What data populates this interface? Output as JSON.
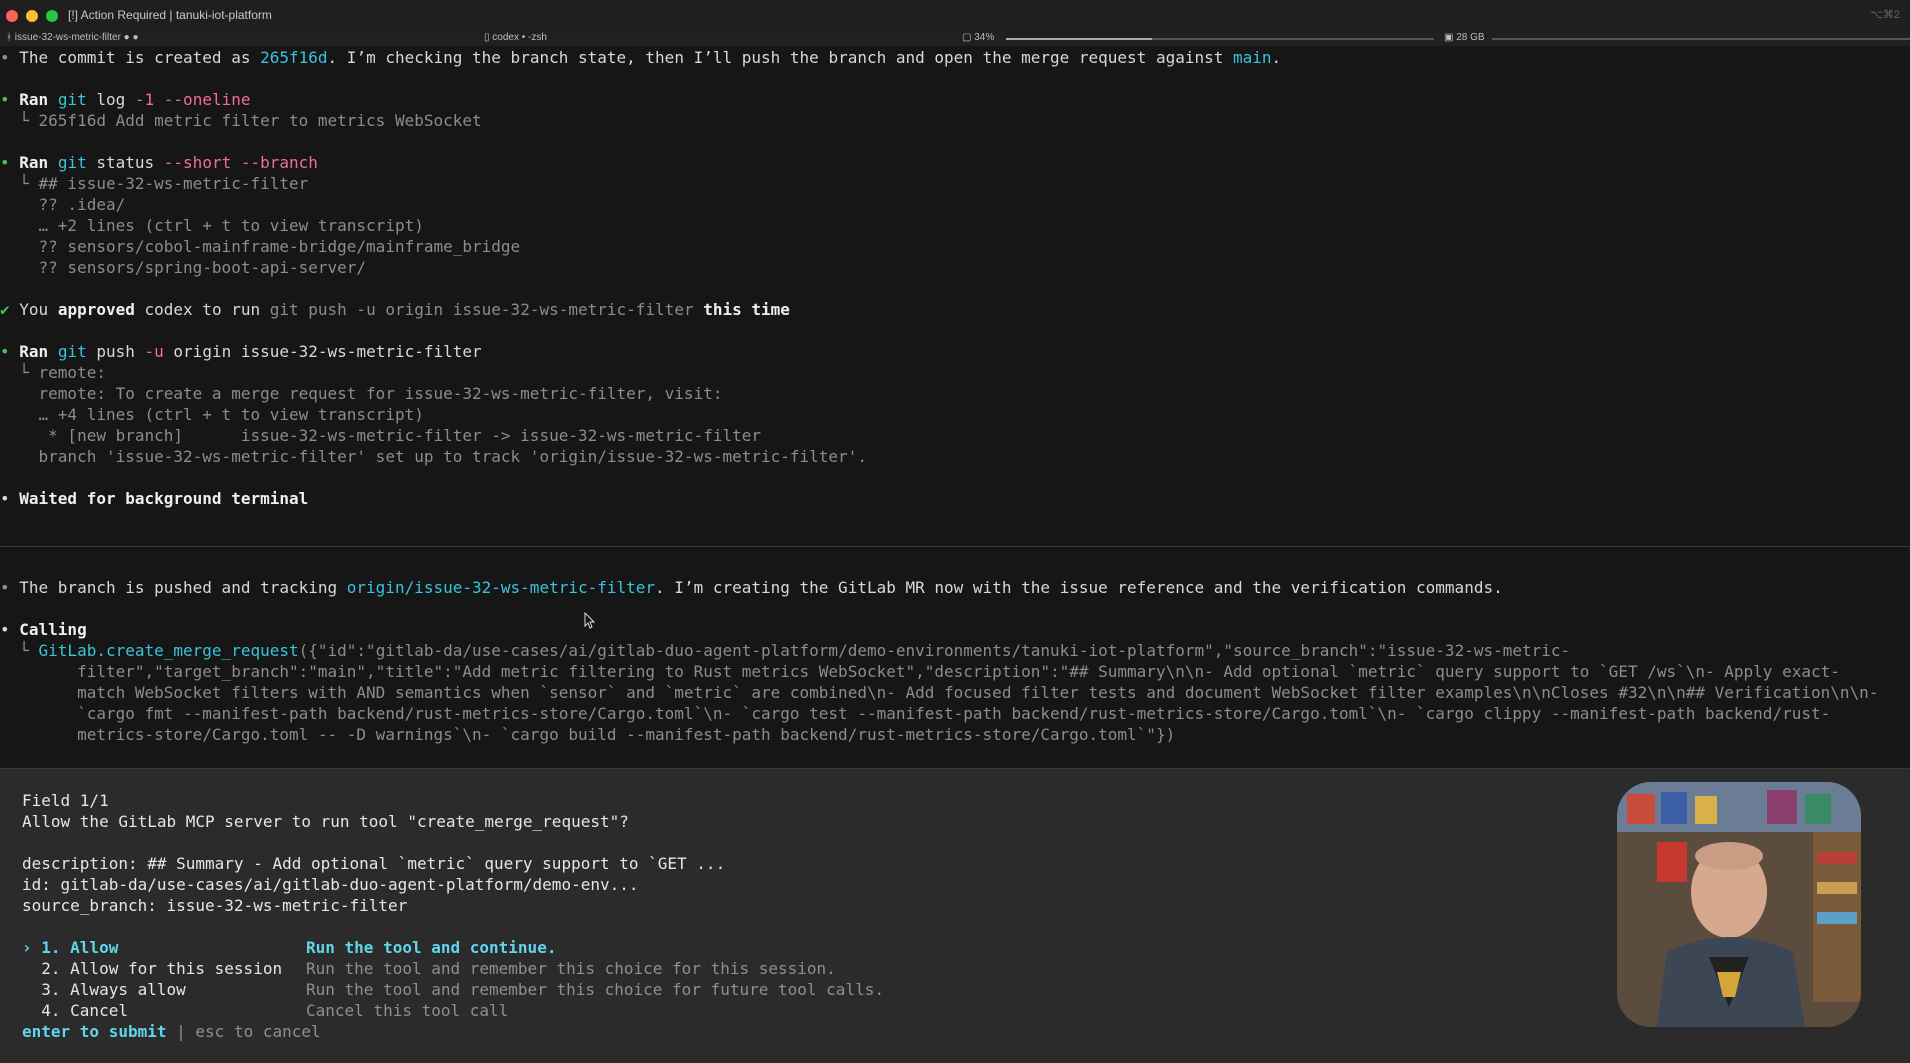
{
  "window": {
    "title": "[!] Action Required | tanuki-iot-platform",
    "shortcut_hint": "⌥⌘2"
  },
  "statusbar": {
    "branch": "issue-32-ws-metric-filter ● ●",
    "tab": "codex • -zsh",
    "cpu": "34%",
    "cpu_level": 0.34,
    "mem": "28 GB"
  },
  "terminal": {
    "commit_line": {
      "prefix": "The commit is created as ",
      "sha": "265f16d",
      "middle": ". I’m checking the branch state, then I’ll push the branch and open the merge request against ",
      "target": "main",
      "suffix": "."
    },
    "cmd1": {
      "ran": "Ran",
      "git": "git",
      "rest": " log ",
      "flags": "-1 --oneline",
      "out": "265f16d Add metric filter to metrics WebSocket"
    },
    "cmd2": {
      "ran": "Ran",
      "git": "git",
      "rest": " status ",
      "flags": "--short --branch",
      "out": [
        "## issue-32-ws-metric-filter",
        "?? .idea/",
        "… +2 lines (ctrl + t to view transcript)",
        "?? sensors/cobol-mainframe-bridge/mainframe_bridge",
        "?? sensors/spring-boot-api-server/"
      ]
    },
    "approval": {
      "check": "✔",
      "you": "You ",
      "approved": "approved",
      "middle": " codex to run ",
      "cmd": "git push -u origin issue-32-ws-metric-filter",
      "this_time": "this time"
    },
    "cmd3": {
      "ran": "Ran",
      "git": "git",
      "rest": " push ",
      "flag": "-u",
      "rest2": " origin issue-32-ws-metric-filter",
      "out": [
        "remote:",
        "remote: To create a merge request for issue-32-ws-metric-filter, visit:",
        "… +4 lines (ctrl + t to view transcript)",
        " * [new branch]      issue-32-ws-metric-filter -> issue-32-ws-metric-filter",
        "branch 'issue-32-ws-metric-filter' set up to track 'origin/issue-32-ws-metric-filter'."
      ]
    },
    "waited": "Waited for background terminal",
    "branch_line": {
      "prefix": "The branch is pushed and tracking ",
      "remote": "origin/issue-32-ws-metric-filter",
      "suffix": ". I’m creating the GitLab MR now with the issue reference and the verification commands."
    },
    "calling": "Calling",
    "call": {
      "obj": "GitLab",
      "method": ".create_merge_request",
      "args": [
        "({\"id\":\"gitlab-da/use-cases/ai/gitlab-duo-agent-platform/demo-environments/tanuki-iot-platform\",\"source_branch\":\"issue-32-ws-metric-",
        "filter\",\"target_branch\":\"main\",\"title\":\"Add metric filtering to Rust metrics WebSocket\",\"description\":\"## Summary\\n\\n- Add optional `metric` query support to `GET /ws`\\n- Apply exact-",
        "match WebSocket filters with AND semantics when `sensor` and `metric` are combined\\n- Add focused filter tests and document WebSocket filter examples\\n\\nCloses #32\\n\\n## Verification\\n\\n-",
        "`cargo fmt --manifest-path backend/rust-metrics-store/Cargo.toml`\\n- `cargo test --manifest-path backend/rust-metrics-store/Cargo.toml`\\n- `cargo clippy --manifest-path backend/rust-",
        "metrics-store/Cargo.toml -- -D warnings`\\n- `cargo build --manifest-path backend/rust-metrics-store/Cargo.toml`\"})"
      ]
    }
  },
  "prompt": {
    "field": "Field 1/1",
    "question": "Allow the GitLab MCP server to run tool \"create_merge_request\"?",
    "params": [
      "description: ## Summary - Add optional `metric` query support to `GET ...",
      "id: gitlab-da/use-cases/ai/gitlab-duo-agent-platform/demo-env...",
      "source_branch: issue-32-ws-metric-filter"
    ],
    "options": [
      {
        "label": "› 1. Allow",
        "desc": "Run the tool and continue."
      },
      {
        "label": "  2. Allow for this session",
        "desc": "Run the tool and remember this choice for this session."
      },
      {
        "label": "  3. Always allow",
        "desc": "Run the tool and remember this choice for future tool calls."
      },
      {
        "label": "  4. Cancel",
        "desc": "Cancel this tool call"
      }
    ],
    "submit": "enter to submit",
    "divider": " | ",
    "cancel": "esc to cancel"
  }
}
